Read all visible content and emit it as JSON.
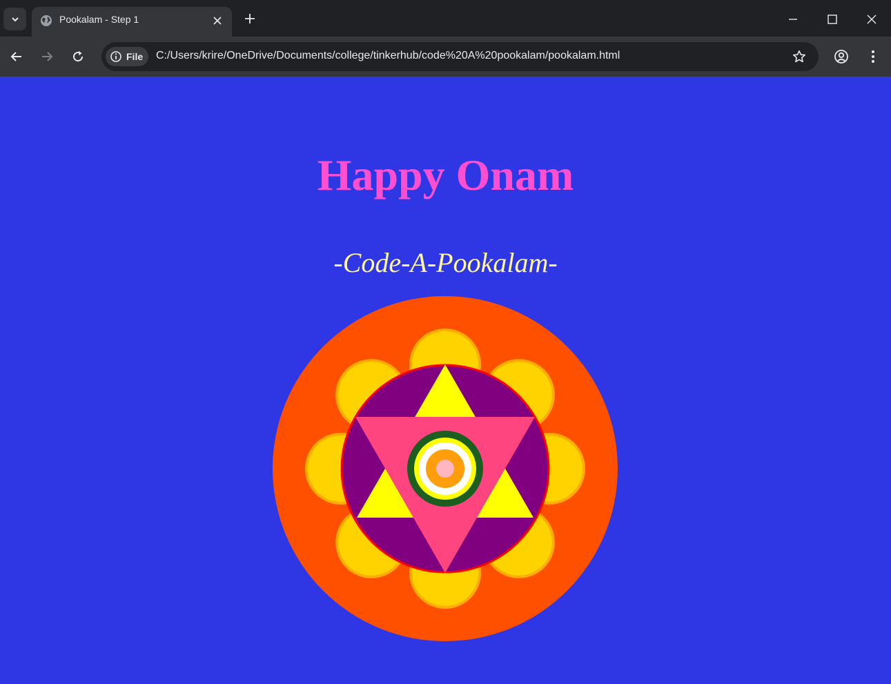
{
  "browser": {
    "tab_title": "Pookalam - Step 1",
    "site_chip_label": "File",
    "url": "C:/Users/krire/OneDrive/Documents/college/tinkerhub/code%20A%20pookalam/pookalam.html"
  },
  "page": {
    "heading": "Happy Onam",
    "subheading": "-Code-A-Pookalam-"
  },
  "colors": {
    "page_background": "#2f37e4",
    "heading": "#ff4fd1",
    "subheading": "#fff7a6",
    "outer_circle": "#ff5000",
    "petal_fill": "#ffd300",
    "petal_outline": "#ffad00",
    "inner_circle": "#800080",
    "inner_circle_border": "#ff0000",
    "upward_triangle": "#ffff00",
    "downward_triangle": "#ff4580",
    "ring_green": "#1b5e20",
    "ring_yellow": "#ffff00",
    "ring_white": "#ffffff",
    "ring_orange": "#ff9d0a",
    "center_dot": "#ffb6c1"
  },
  "icons": [
    "tab-search-icon",
    "globe-icon",
    "close-icon",
    "plus-icon",
    "minimize-icon",
    "maximize-icon",
    "window-close-icon",
    "back-arrow-icon",
    "forward-arrow-icon",
    "reload-icon",
    "info-icon",
    "star-icon",
    "profile-icon",
    "kebab-menu-icon"
  ]
}
